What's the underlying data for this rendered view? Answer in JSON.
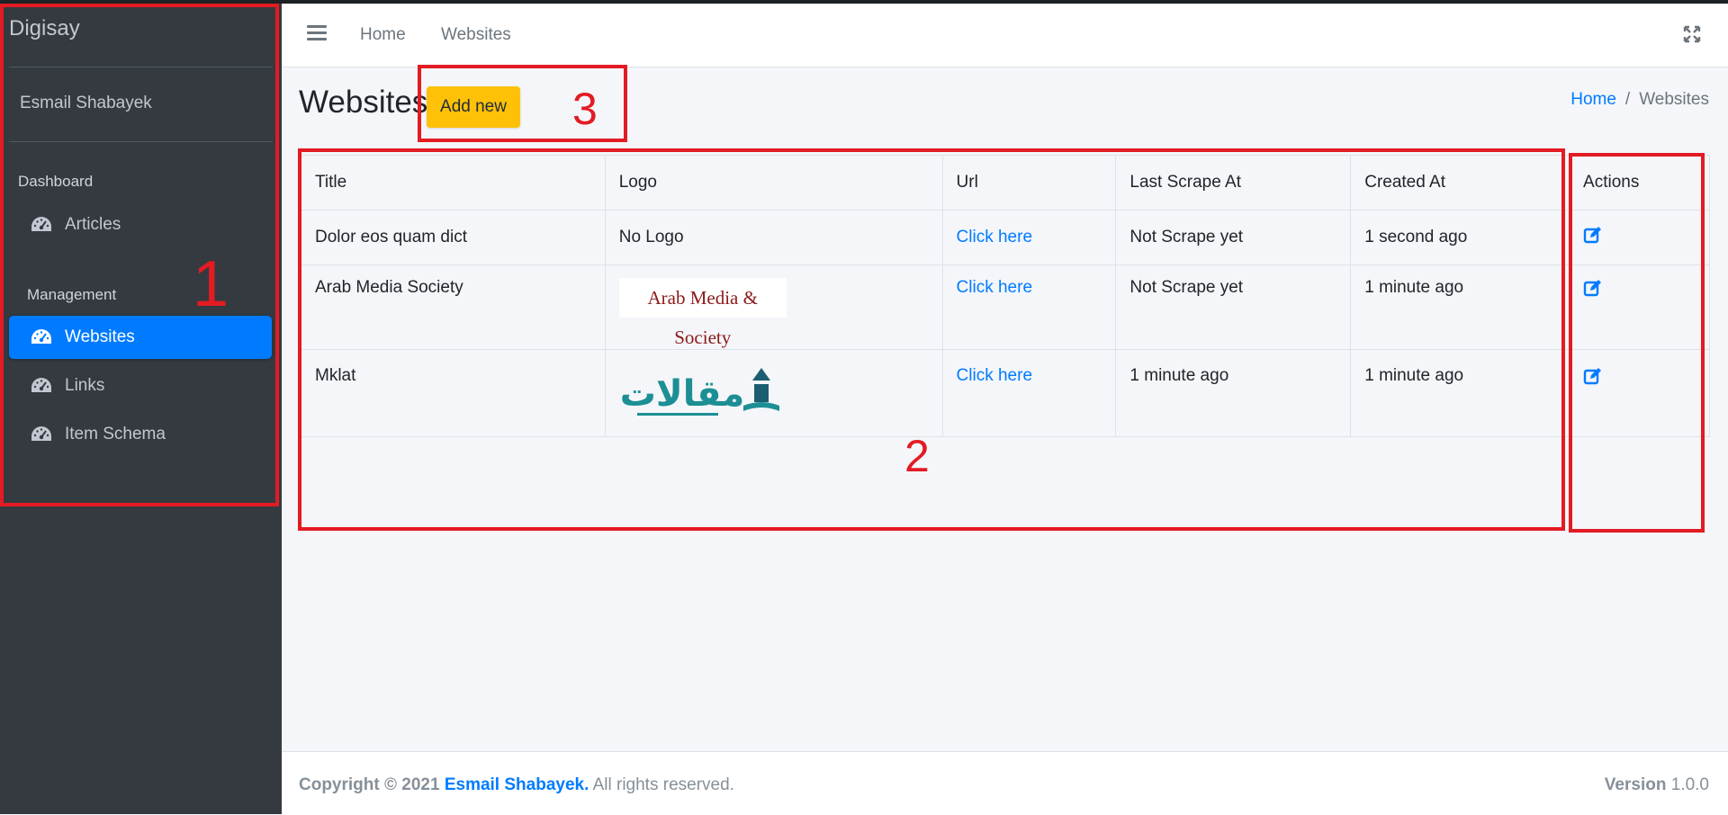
{
  "brand": "Digisay",
  "user_name": "Esmail Shabayek",
  "sidebar": {
    "sections": [
      {
        "header": "Dashboard",
        "items": [
          {
            "label": "Articles",
            "icon": "tachometer-icon",
            "active": false
          }
        ]
      },
      {
        "header": "Management",
        "items": [
          {
            "label": "Websites",
            "icon": "tachometer-icon",
            "active": true
          },
          {
            "label": "Links",
            "icon": "tachometer-icon",
            "active": false
          },
          {
            "label": "Item Schema",
            "icon": "tachometer-icon",
            "active": false
          }
        ]
      }
    ]
  },
  "navbar": {
    "links": [
      "Home",
      "Websites"
    ],
    "menu_icon": "hamburger-icon",
    "fullscreen_icon": "expand-icon"
  },
  "page": {
    "title": "Websites",
    "add_button": "Add new",
    "breadcrumb": {
      "home": "Home",
      "separator": "/",
      "current": "Websites"
    }
  },
  "table": {
    "columns": [
      "Title",
      "Logo",
      "Url",
      "Last Scrape At",
      "Created At",
      "Actions"
    ],
    "rows": [
      {
        "title": "Dolor eos quam dict",
        "logo": "No Logo",
        "url": "Click here",
        "last_scrape": "Not Scrape yet",
        "created": "1 second ago",
        "action_icon": "edit-icon"
      },
      {
        "title": "Arab Media Society",
        "logo": "Arab Media & Society",
        "url": "Click here",
        "last_scrape": "Not Scrape yet",
        "created": "1 minute ago",
        "action_icon": "edit-icon"
      },
      {
        "title": "Mklat",
        "logo": "مقالات",
        "url": "Click here",
        "last_scrape": "1 minute ago",
        "created": "1 minute ago",
        "action_icon": "edit-icon"
      }
    ]
  },
  "annotations": [
    "1",
    "2",
    "3"
  ],
  "footer": {
    "copyright": "Copyright © 2021",
    "author": "Esmail Shabayek.",
    "rights": "All rights reserved.",
    "version_label": "Version",
    "version": "1.0.0"
  },
  "colors": {
    "sidebar_bg": "#343a40",
    "active": "#007bff",
    "add_button": "#ffc107",
    "annotation": "#e31b23",
    "link": "#007bff"
  }
}
